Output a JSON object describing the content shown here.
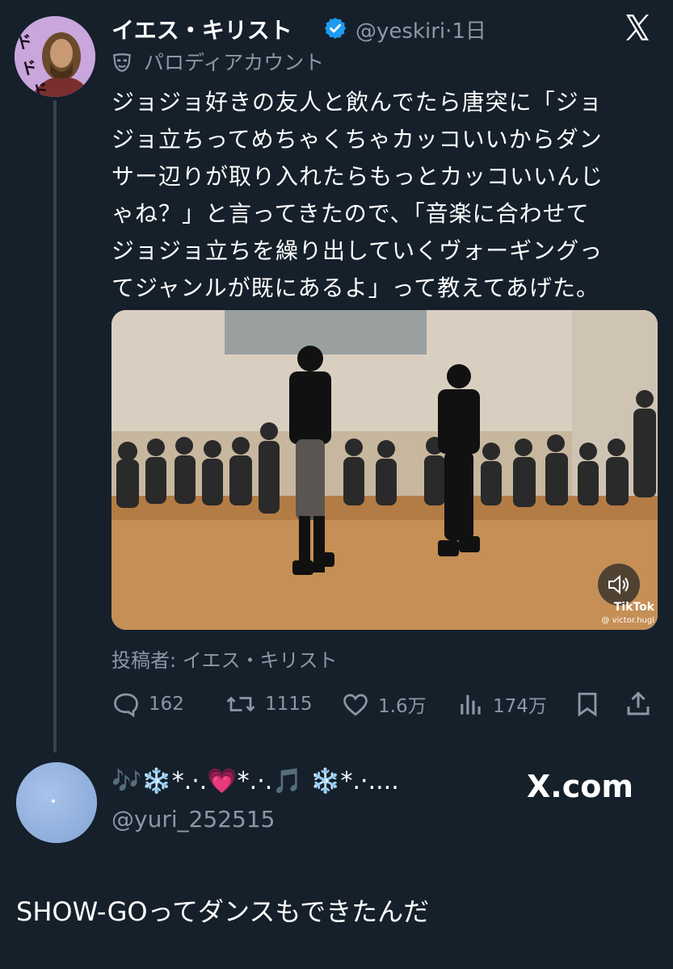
{
  "tweet": {
    "author_name": "イエス・キリスト",
    "handle": "@yeskiri",
    "separator": "·",
    "time": "1日",
    "parody_label": "パロディアカウント",
    "text_lines": [
      "ジョジョ好きの友人と飲んでたら唐突に「ジョ",
      "ジョ立ちってめちゃくちゃカッコいいからダン",
      "サー辺りが取り入れたらもっとカッコいいんじ",
      "ゃね？」と言ってきたので、「音楽に合わせて",
      "ジョジョ立ちを繰り出していくヴォーギングっ",
      "てジャンルが既にあるよ」って教えてあげた。"
    ],
    "media": {
      "watermark_logo": "TikTok",
      "watermark_handle": "@ victor.hugi"
    },
    "posted_by": "投稿者: イエス・キリスト",
    "stats": {
      "replies": "162",
      "reposts": "1115",
      "likes": "1.6万",
      "views": "174万"
    }
  },
  "reply": {
    "display_name": "🎶❄️*.·.💗*.·.🎵 ❄️*.·....",
    "handle": "@yuri_252515",
    "text": "SHOW-GOってダンスもできたんだ"
  },
  "watermark_site": "X.com",
  "colors": {
    "background": "#15202b",
    "secondary_text": "#8b98a5",
    "verified_blue": "#1d9bf0",
    "thread_line": "#38444d"
  },
  "icons": [
    "close-x-icon",
    "verified-badge-icon",
    "parody-mask-icon",
    "reply-icon",
    "repost-icon",
    "like-icon",
    "views-icon",
    "bookmark-icon",
    "share-icon",
    "sound-icon"
  ]
}
